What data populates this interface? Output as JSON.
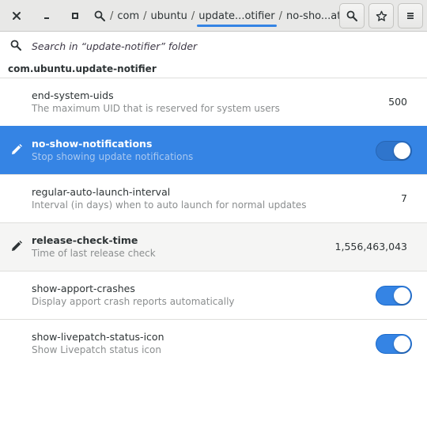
{
  "headerbar": {
    "icons": [
      "close-icon",
      "minimize-icon",
      "maximize-icon",
      "search-icon",
      "star-icon",
      "menu-icon"
    ],
    "path": [
      {
        "label": "/",
        "kind": "sep"
      },
      {
        "label": "com",
        "kind": "seg"
      },
      {
        "label": "/",
        "kind": "sep"
      },
      {
        "label": "ubuntu",
        "kind": "seg"
      },
      {
        "label": "/",
        "kind": "sep"
      },
      {
        "label": "update...otifier",
        "kind": "seg",
        "active": true
      },
      {
        "label": "/",
        "kind": "sep"
      },
      {
        "label": "no-sho...ations",
        "kind": "seg"
      }
    ]
  },
  "search": {
    "placeholder": "Search in “update-notifier” folder"
  },
  "folder_label": "com.ubuntu.update-notifier",
  "accent_color": "#3584e4",
  "keys": [
    {
      "name": "end-system-uids",
      "description": "The maximum UID that is reserved for system users",
      "value": "500",
      "kind": "value",
      "modified": false,
      "selected": false
    },
    {
      "name": "no-show-notifications",
      "description": "Stop showing update notifications",
      "value": "on",
      "kind": "switch",
      "modified": true,
      "selected": true
    },
    {
      "name": "regular-auto-launch-interval",
      "description": "Interval (in days) when to auto launch for normal updates",
      "value": "7",
      "kind": "value",
      "modified": false,
      "selected": false
    },
    {
      "name": "release-check-time",
      "description": "Time of last release check",
      "value": "1,556,463,043",
      "kind": "value",
      "modified": true,
      "selected": false
    },
    {
      "name": "show-apport-crashes",
      "description": "Display apport crash reports automatically",
      "value": "on",
      "kind": "switch",
      "modified": false,
      "selected": false
    },
    {
      "name": "show-livepatch-status-icon",
      "description": "Show Livepatch status icon",
      "value": "on",
      "kind": "switch",
      "modified": false,
      "selected": false
    }
  ]
}
